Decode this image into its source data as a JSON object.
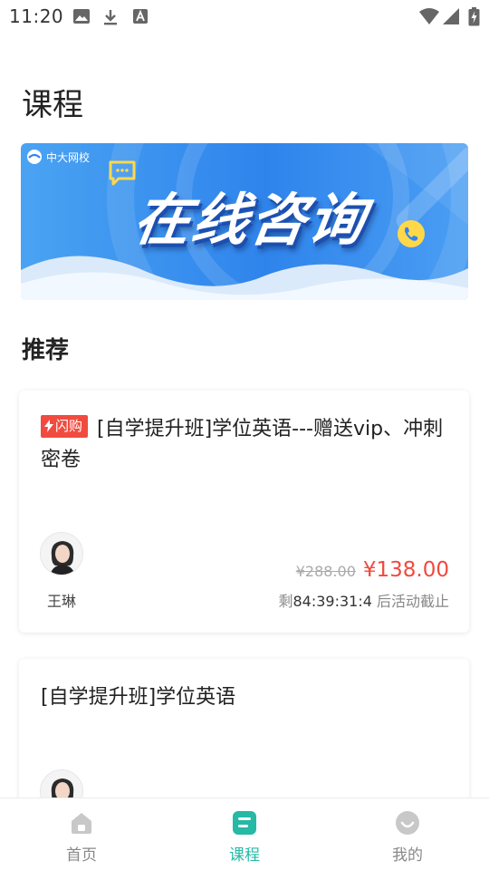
{
  "status_bar": {
    "time": "11:20",
    "left_icons": [
      "image-icon",
      "download-icon",
      "font-icon"
    ],
    "right_icons": [
      "wifi-icon",
      "signal-icon",
      "battery-icon"
    ]
  },
  "page": {
    "title": "课程"
  },
  "banner": {
    "logo_text": "中大网校",
    "title": "在线咨询"
  },
  "section": {
    "title": "推荐"
  },
  "courses": [
    {
      "badge": "闪购",
      "title": "[自学提升班]学位英语---赠送vip、冲刺密卷",
      "teacher": "王琳",
      "original_price": "¥288.00",
      "price": "¥138.00",
      "countdown_prefix": "剩",
      "countdown_time": "84:39:31:4",
      "countdown_suffix": " 后活动截止"
    },
    {
      "title": "[自学提升班]学位英语"
    }
  ],
  "bottom_nav": {
    "items": [
      {
        "label": "首页",
        "icon": "home-icon",
        "active": false
      },
      {
        "label": "课程",
        "icon": "course-icon",
        "active": true
      },
      {
        "label": "我的",
        "icon": "profile-icon",
        "active": false
      }
    ]
  },
  "colors": {
    "accent": "#25b9a6",
    "price": "#f04a3e",
    "flash_badge": "#f14b3f",
    "banner_blue": "#2f84ec"
  }
}
